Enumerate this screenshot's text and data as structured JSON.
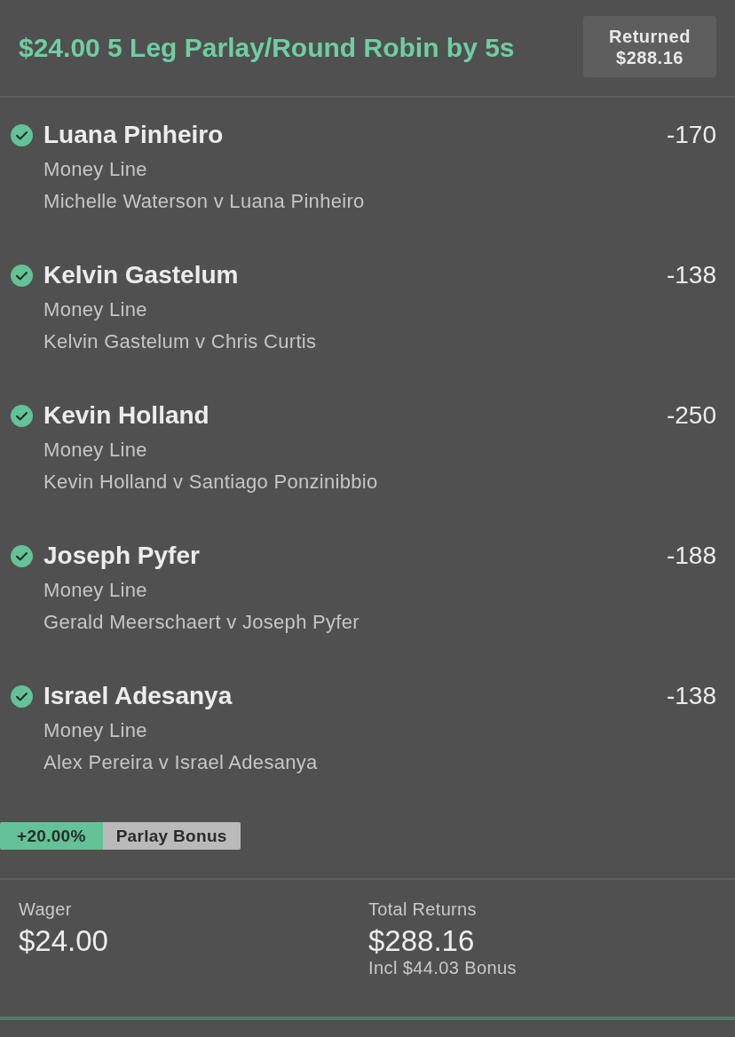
{
  "header": {
    "title": "$24.00 5 Leg Parlay/Round Robin by 5s",
    "returned": {
      "label": "Returned",
      "amount": "$288.16"
    }
  },
  "legs": [
    {
      "won": true,
      "selection": "Luana Pinheiro",
      "odds": "-170",
      "market": "Money Line",
      "event": "Michelle Waterson v Luana Pinheiro"
    },
    {
      "won": true,
      "selection": "Kelvin Gastelum",
      "odds": "-138",
      "market": "Money Line",
      "event": "Kelvin Gastelum v Chris Curtis"
    },
    {
      "won": true,
      "selection": "Kevin Holland",
      "odds": "-250",
      "market": "Money Line",
      "event": "Kevin Holland v Santiago Ponzinibbio"
    },
    {
      "won": true,
      "selection": "Joseph Pyfer",
      "odds": "-188",
      "market": "Money Line",
      "event": "Gerald Meerschaert v Joseph Pyfer"
    },
    {
      "won": true,
      "selection": "Israel Adesanya",
      "odds": "-138",
      "market": "Money Line",
      "event": "Alex Pereira v Israel Adesanya"
    }
  ],
  "bonus": {
    "percent": "+20.00%",
    "label": "Parlay Bonus"
  },
  "summary": {
    "wager": {
      "label": "Wager",
      "amount": "$24.00"
    },
    "total_returns": {
      "label": "Total Returns",
      "amount": "$288.16",
      "note": "Incl $44.03 Bonus"
    }
  }
}
